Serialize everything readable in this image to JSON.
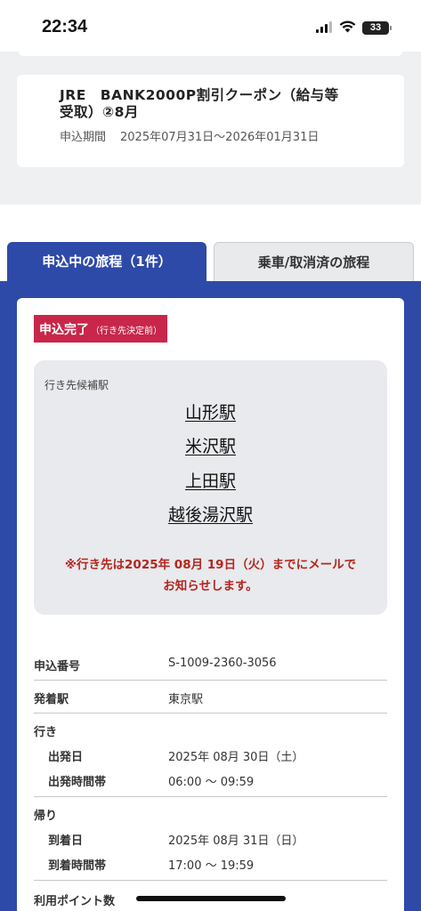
{
  "status_bar": {
    "time": "22:34",
    "battery": "33"
  },
  "coupon": {
    "title_line1": "JRE　BANK2000P割引クーポン（給与等",
    "title_line2": "受取）②8月",
    "period_label": "申込期間",
    "period_value": "2025年07月31日〜2026年01月31日"
  },
  "tabs": {
    "active": "申込中の旅程（1件）",
    "inactive": "乗車/取消済の旅程"
  },
  "status": {
    "main": "申込完了",
    "sub": "（行き先決定前）"
  },
  "candidates": {
    "label": "行き先候補駅",
    "stations": [
      "山形駅",
      "米沢駅",
      "上田駅",
      "越後湯沢駅"
    ],
    "notice_line1": "※行き先は2025年 08月 19日（火）までにメールで",
    "notice_line2": "お知らせします。"
  },
  "details": {
    "application_number_label": "申込番号",
    "application_number": "S-1009-2360-3056",
    "departure_station_label": "発着駅",
    "departure_station": "東京駅",
    "outbound": {
      "label": "行き",
      "date_label": "出発日",
      "date": "2025年 08月 30日（土）",
      "time_label": "出発時間帯",
      "time": "06:00 〜 09:59"
    },
    "return": {
      "label": "帰り",
      "date_label": "到着日",
      "date": "2025年 08月 31日（日）",
      "time_label": "到着時間帯",
      "time": "17:00 〜 19:59"
    },
    "points_label": "利用ポイント数"
  },
  "colors": {
    "brand_blue": "#2e4aa8",
    "badge_red": "#c8264a",
    "notice_red": "#b3261e"
  },
  "icons": [
    "signal-icon",
    "wifi-icon",
    "battery-icon"
  ]
}
